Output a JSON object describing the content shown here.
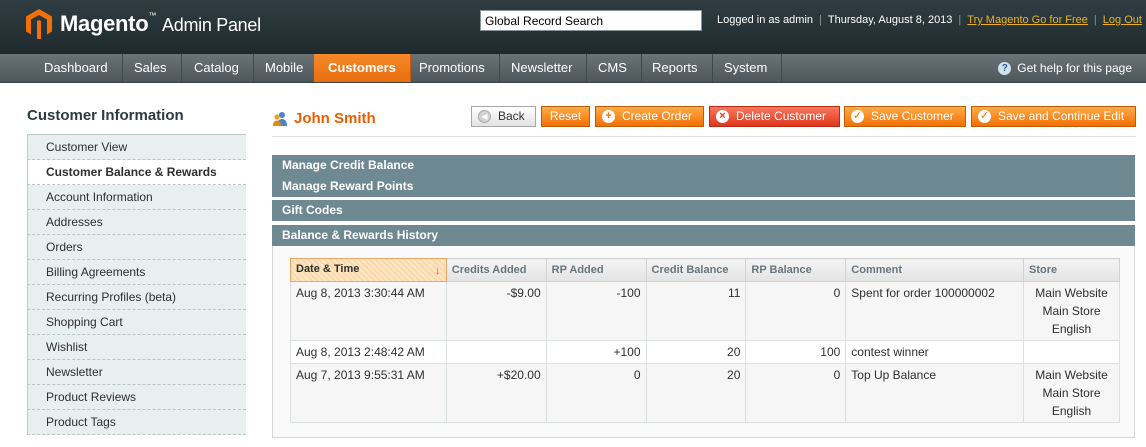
{
  "header": {
    "logo_text": "Magento",
    "logo_tm": "™",
    "logo_sub": "Admin Panel",
    "search_value": "Global Record Search",
    "logged_in": "Logged in as admin",
    "date": "Thursday, August 8, 2013",
    "try_link": "Try Magento Go for Free",
    "logout": "Log Out",
    "brand_color": "#f46f05"
  },
  "nav": {
    "items": [
      "Dashboard",
      "Sales",
      "Catalog",
      "Mobile",
      "Customers",
      "Promotions",
      "Newsletter",
      "CMS",
      "Reports",
      "System"
    ],
    "active": "Customers",
    "help": "Get help for this page"
  },
  "sidebar": {
    "title": "Customer Information",
    "items": [
      "Customer View",
      "Customer Balance & Rewards",
      "Account Information",
      "Addresses",
      "Orders",
      "Billing Agreements",
      "Recurring Profiles (beta)",
      "Shopping Cart",
      "Wishlist",
      "Newsletter",
      "Product Reviews",
      "Product Tags"
    ],
    "active": "Customer Balance & Rewards"
  },
  "page": {
    "title": "John Smith",
    "buttons": {
      "back": "Back",
      "reset": "Reset",
      "create_order": "Create Order",
      "delete_customer": "Delete Customer",
      "save_customer": "Save Customer",
      "save_continue": "Save and Continue Edit"
    }
  },
  "sections": {
    "credit": "Manage Credit Balance",
    "reward": "Manage Reward Points",
    "gift": "Gift Codes",
    "history": "Balance & Rewards History"
  },
  "table": {
    "columns": [
      "Date & Time",
      "Credits Added",
      "RP Added",
      "Credit Balance",
      "RP Balance",
      "Comment",
      "Store"
    ],
    "rows": [
      {
        "date": "Aug 8, 2013 3:30:44 AM",
        "credits": "-$9.00",
        "rp": "-100",
        "credit_balance": "11",
        "rp_balance": "0",
        "comment": "Spent for order 100000002",
        "store": [
          "Main Website",
          "Main Store",
          "English"
        ]
      },
      {
        "date": "Aug 8, 2013 2:48:42 AM",
        "credits": "",
        "rp": "+100",
        "credit_balance": "20",
        "rp_balance": "100",
        "comment": "contest winner",
        "store": []
      },
      {
        "date": "Aug 7, 2013 9:55:31 AM",
        "credits": "+$20.00",
        "rp": "0",
        "credit_balance": "20",
        "rp_balance": "0",
        "comment": "Top Up Balance",
        "store": [
          "Main Website",
          "Main Store",
          "English"
        ]
      }
    ]
  }
}
